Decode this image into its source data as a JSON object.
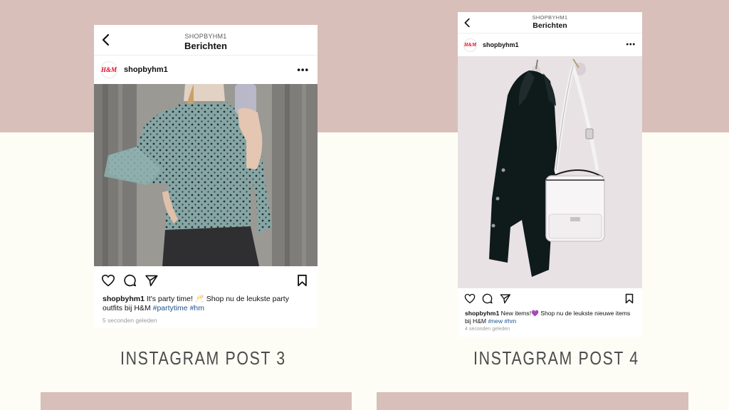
{
  "posts": [
    {
      "header_username": "SHOPBYHM1",
      "header_title": "Berichten",
      "avatar_text": "H&M",
      "profile_name": "shopbyhm1",
      "more": "•••",
      "caption_user": "shopbyhm1",
      "caption_text_1": " It's party time! 🥂 Shop nu de leukste party outfits bij H&M ",
      "tag_1": "#partytime",
      "tag_2": "#hm",
      "timestamp": "5 seconden geleden",
      "label": "INSTAGRAM POST 3"
    },
    {
      "header_username": "SHOPBYHM1",
      "header_title": "Berichten",
      "avatar_text": "H&M",
      "profile_name": "shopbyhm1",
      "more": "•••",
      "caption_user": "shopbyhm1",
      "caption_text_1": " New items!💜 Shop nu de leukste nieuwe items bij H&M ",
      "tag_1": "#new",
      "tag_2": "#hm",
      "timestamp": "4 seconden geleden",
      "label": "INSTAGRAM POST 4"
    }
  ],
  "icons": {
    "back": "chevron-left-icon",
    "like": "heart-icon",
    "comment": "comment-icon",
    "share": "send-icon",
    "save": "bookmark-icon"
  },
  "colors": {
    "band": "#d8bfb9",
    "background": "#fdfdf6",
    "hashtag": "#22548e",
    "brand_red": "#e3001b"
  }
}
